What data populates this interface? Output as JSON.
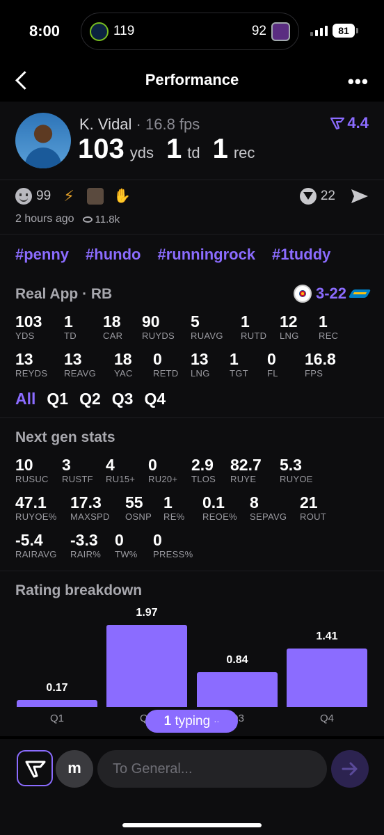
{
  "status_bar": {
    "time": "8:00",
    "score_left": "119",
    "score_right": "92",
    "battery": "81"
  },
  "nav": {
    "title": "Performance",
    "more": "•••"
  },
  "player": {
    "name": "K. Vidal",
    "fps": "· 16.8 fps",
    "rating": "4.4",
    "yds": "103",
    "yds_unit": "yds",
    "td": "1",
    "td_unit": "td",
    "rec": "1",
    "rec_unit": "rec"
  },
  "reactions": {
    "smile_count": "99",
    "vote_count": "22",
    "posted": "2 hours ago",
    "views": "11.8k"
  },
  "tags": [
    "#penny",
    "#hundo",
    "#runningrock",
    "#1tuddy"
  ],
  "game": {
    "title": "Real App · RB",
    "score": "3-22",
    "stats_row1": [
      {
        "v": "103",
        "l": "YDS"
      },
      {
        "v": "1",
        "l": "TD"
      },
      {
        "v": "18",
        "l": "CAR"
      },
      {
        "v": "90",
        "l": "RUYDS"
      },
      {
        "v": "5",
        "l": "RUAVG"
      },
      {
        "v": "1",
        "l": "RUTD"
      },
      {
        "v": "12",
        "l": "LNG"
      },
      {
        "v": "1",
        "l": "REC"
      }
    ],
    "stats_row2": [
      {
        "v": "13",
        "l": "REYDS"
      },
      {
        "v": "13",
        "l": "REAVG"
      },
      {
        "v": "18",
        "l": "YAC"
      },
      {
        "v": "0",
        "l": "RETD"
      },
      {
        "v": "13",
        "l": "LNG"
      },
      {
        "v": "1",
        "l": "TGT"
      },
      {
        "v": "0",
        "l": "FL"
      },
      {
        "v": "16.8",
        "l": "FPS"
      }
    ],
    "tabs": [
      "All",
      "Q1",
      "Q2",
      "Q3",
      "Q4"
    ]
  },
  "next_gen": {
    "title": "Next gen stats",
    "row1": [
      {
        "v": "10",
        "l": "RUSUC"
      },
      {
        "v": "3",
        "l": "RUSTF"
      },
      {
        "v": "4",
        "l": "RU15+"
      },
      {
        "v": "0",
        "l": "RU20+"
      },
      {
        "v": "2.9",
        "l": "TLOS"
      },
      {
        "v": "82.7",
        "l": "RUYE"
      },
      {
        "v": "5.3",
        "l": "RUYOE"
      }
    ],
    "row2": [
      {
        "v": "47.1",
        "l": "RUYOE%"
      },
      {
        "v": "17.3",
        "l": "MAXSPD"
      },
      {
        "v": "55",
        "l": "OSNP"
      },
      {
        "v": "1",
        "l": "RE%"
      },
      {
        "v": "0.1",
        "l": "REOE%"
      },
      {
        "v": "8",
        "l": "SEPAVG"
      },
      {
        "v": "21",
        "l": "ROUT"
      }
    ],
    "row3": [
      {
        "v": "-5.4",
        "l": "RAIRAVG"
      },
      {
        "v": "-3.3",
        "l": "RAIR%"
      },
      {
        "v": "0",
        "l": "TW%"
      },
      {
        "v": "0",
        "l": "PRESS%"
      }
    ]
  },
  "chart_title": "Rating breakdown",
  "chart_data": {
    "type": "bar",
    "categories": [
      "Q1",
      "Q2",
      "Q3",
      "Q4"
    ],
    "values": [
      0.17,
      1.97,
      0.84,
      1.41
    ],
    "title": "Rating breakdown"
  },
  "typing": {
    "count": "1",
    "text": "typing",
    "dots": "··"
  },
  "composer": {
    "avatar_letter": "m",
    "placeholder": "To General..."
  },
  "colors": {
    "accent": "#8b6cff",
    "background": "#000000",
    "panel": "#0d0d0f"
  }
}
